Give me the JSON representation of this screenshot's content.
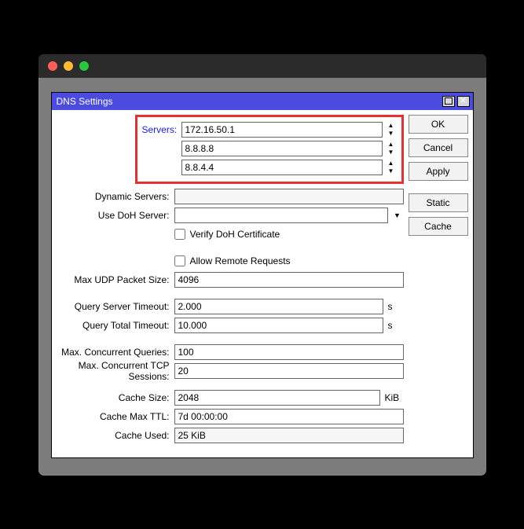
{
  "dialog": {
    "title": "DNS Settings"
  },
  "fields": {
    "servers_label": "Servers:",
    "server1": "172.16.50.1",
    "server2": "8.8.8.8",
    "server3": "8.8.4.4",
    "dynamic_servers_label": "Dynamic Servers:",
    "dynamic_servers_value": "",
    "use_doh_label": "Use DoH Server:",
    "use_doh_value": "",
    "verify_doh_label": "Verify DoH Certificate",
    "allow_remote_label": "Allow Remote Requests",
    "max_udp_label": "Max UDP Packet Size:",
    "max_udp_value": "4096",
    "query_server_timeout_label": "Query Server Timeout:",
    "query_server_timeout_value": "2.000",
    "query_total_timeout_label": "Query Total Timeout:",
    "query_total_timeout_value": "10.000",
    "timeout_unit": "s",
    "max_conc_queries_label": "Max. Concurrent Queries:",
    "max_conc_queries_value": "100",
    "max_conc_tcp_label": "Max. Concurrent TCP Sessions:",
    "max_conc_tcp_value": "20",
    "cache_size_label": "Cache Size:",
    "cache_size_value": "2048",
    "cache_size_unit": "KiB",
    "cache_max_ttl_label": "Cache Max TTL:",
    "cache_max_ttl_value": "7d 00:00:00",
    "cache_used_label": "Cache Used:",
    "cache_used_value": "25 KiB"
  },
  "buttons": {
    "ok": "OK",
    "cancel": "Cancel",
    "apply": "Apply",
    "static": "Static",
    "cache": "Cache"
  }
}
